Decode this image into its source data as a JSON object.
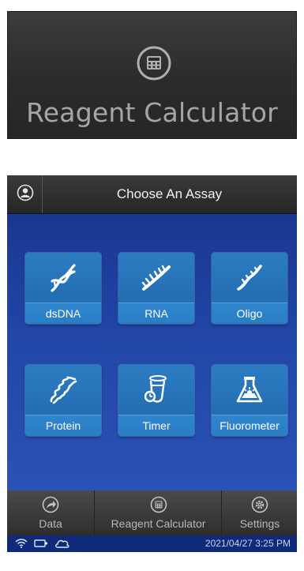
{
  "callout": {
    "label": "Reagent Calculator",
    "icon": "calculator-icon"
  },
  "header": {
    "title": "Choose An Assay",
    "user_icon": "user-icon"
  },
  "assays": [
    {
      "label": "dsDNA",
      "icon": "dsdna-helix-icon"
    },
    {
      "label": "RNA",
      "icon": "rna-strand-icon"
    },
    {
      "label": "Oligo",
      "icon": "oligo-strand-icon"
    },
    {
      "label": "Protein",
      "icon": "protein-coil-icon"
    },
    {
      "label": "Timer",
      "icon": "timer-tube-icon"
    },
    {
      "label": "Fluorometer",
      "icon": "fluorometer-flask-icon"
    }
  ],
  "navbar": {
    "items": [
      {
        "label": "Data",
        "icon": "export-arrow-icon"
      },
      {
        "label": "Reagent Calculator",
        "icon": "calculator-icon"
      },
      {
        "label": "Settings",
        "icon": "gear-icon"
      }
    ]
  },
  "status": {
    "datetime": "2021/04/27  3:25 PM",
    "icons": [
      "wifi-icon",
      "usb-icon",
      "cloud-icon"
    ]
  },
  "colors": {
    "screen_bg": "#1f3f95",
    "tile": "#2b7dc4",
    "bar": "#2e2e2e"
  }
}
